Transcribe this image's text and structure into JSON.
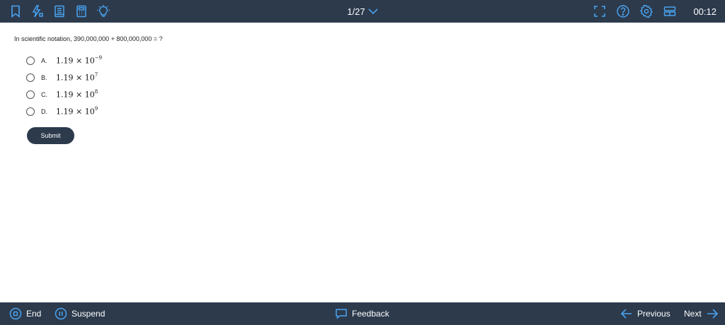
{
  "toolbar": {
    "left_icons": [
      "bookmark-icon",
      "flash-icon",
      "notebook-icon",
      "calculator-icon",
      "lightbulb-icon"
    ],
    "question_counter": "1/27",
    "right_icons": [
      "fullscreen-icon",
      "help-icon",
      "gear-icon",
      "layout-icon"
    ],
    "timer": "00:12"
  },
  "question": {
    "text": "In scientific notation, 390,000,000 + 800,000,000 = ?",
    "options": [
      {
        "letter": "A.",
        "mantissa": "1.19 × 10",
        "exponent": "−9"
      },
      {
        "letter": "B.",
        "mantissa": "1.19 × 10",
        "exponent": "7"
      },
      {
        "letter": "C.",
        "mantissa": "1.19 × 10",
        "exponent": "8"
      },
      {
        "letter": "D.",
        "mantissa": "1.19 × 10",
        "exponent": "9"
      }
    ],
    "submit_label": "Submit"
  },
  "footer": {
    "end_label": "End",
    "suspend_label": "Suspend",
    "feedback_label": "Feedback",
    "previous_label": "Previous",
    "next_label": "Next"
  },
  "colors": {
    "bar_background": "#2c3a4c",
    "icon_accent": "#4aa3f0",
    "text_light": "#ffffff"
  }
}
